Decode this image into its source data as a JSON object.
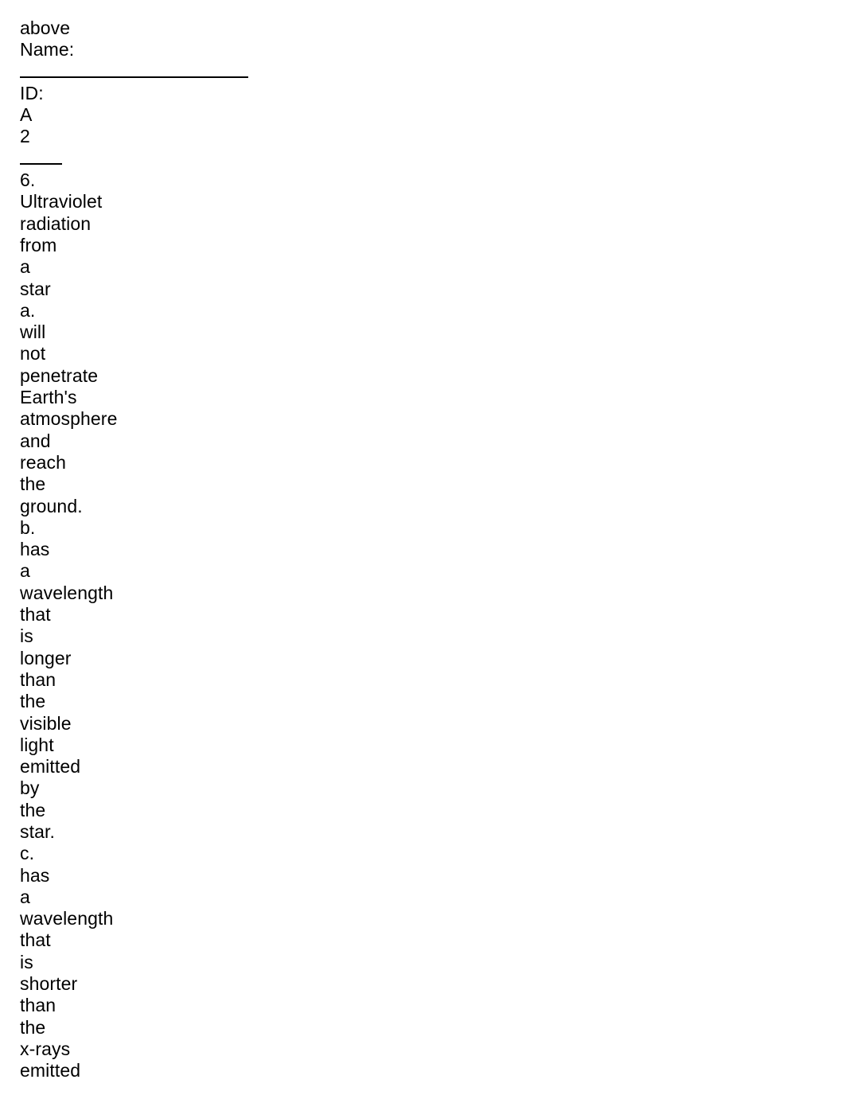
{
  "document": {
    "page_background": "#ffffff",
    "text_color": "#000000",
    "lines": [
      {
        "type": "text",
        "text": "above"
      },
      {
        "type": "text",
        "text": "Name:"
      },
      {
        "type": "rule",
        "style": "long",
        "text": "______________________"
      },
      {
        "type": "text",
        "text": "ID:"
      },
      {
        "type": "text",
        "text": "A"
      },
      {
        "type": "text",
        "text": "2"
      },
      {
        "type": "rule",
        "style": "short",
        "text": "____"
      },
      {
        "type": "text",
        "text": "6."
      },
      {
        "type": "text",
        "text": "Ultraviolet"
      },
      {
        "type": "text",
        "text": "radiation"
      },
      {
        "type": "text",
        "text": "from"
      },
      {
        "type": "text",
        "text": "a"
      },
      {
        "type": "text",
        "text": "star"
      },
      {
        "type": "text",
        "text": "a."
      },
      {
        "type": "text",
        "text": "will"
      },
      {
        "type": "text",
        "text": "not"
      },
      {
        "type": "text",
        "text": "penetrate"
      },
      {
        "type": "text",
        "text": "Earth's"
      },
      {
        "type": "text",
        "text": "atmosphere"
      },
      {
        "type": "text",
        "text": "and"
      },
      {
        "type": "text",
        "text": "reach"
      },
      {
        "type": "text",
        "text": "the"
      },
      {
        "type": "text",
        "text": "ground."
      },
      {
        "type": "text",
        "text": "b."
      },
      {
        "type": "text",
        "text": "has"
      },
      {
        "type": "text",
        "text": "a"
      },
      {
        "type": "text",
        "text": "wavelength"
      },
      {
        "type": "text",
        "text": "that"
      },
      {
        "type": "text",
        "text": "is"
      },
      {
        "type": "text",
        "text": "longer"
      },
      {
        "type": "text",
        "text": "than"
      },
      {
        "type": "text",
        "text": "the"
      },
      {
        "type": "text",
        "text": "visible"
      },
      {
        "type": "text",
        "text": "light"
      },
      {
        "type": "text",
        "text": "emitted"
      },
      {
        "type": "text",
        "text": "by"
      },
      {
        "type": "text",
        "text": "the"
      },
      {
        "type": "text",
        "text": "star."
      },
      {
        "type": "text",
        "text": "c."
      },
      {
        "type": "text",
        "text": "has"
      },
      {
        "type": "text",
        "text": "a"
      },
      {
        "type": "text",
        "text": "wavelength"
      },
      {
        "type": "text",
        "text": "that"
      },
      {
        "type": "text",
        "text": "is"
      },
      {
        "type": "text",
        "text": "shorter"
      },
      {
        "type": "text",
        "text": "than"
      },
      {
        "type": "text",
        "text": "the"
      },
      {
        "type": "text",
        "text": "x-rays"
      },
      {
        "type": "text",
        "text": "emitted"
      }
    ]
  }
}
